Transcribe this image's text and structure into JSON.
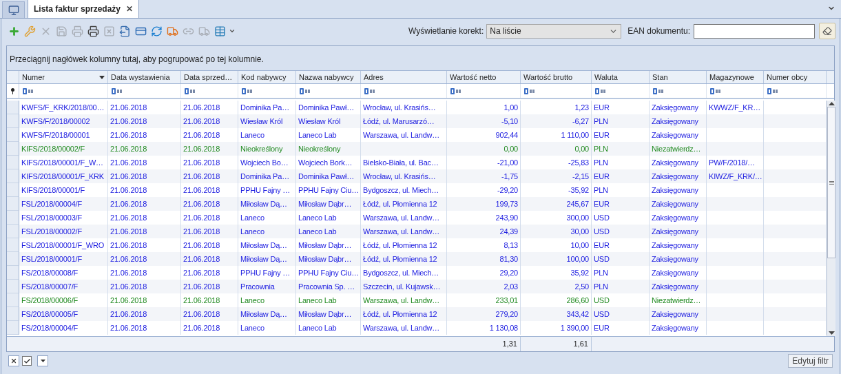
{
  "tabs": [
    {
      "kind": "home",
      "selected": false
    },
    {
      "kind": "document",
      "label": "Lista faktur sprzedaży",
      "close": "✕",
      "selected": true
    }
  ],
  "toolbar": [
    {
      "kind": "add",
      "disabled": false
    },
    {
      "kind": "edit",
      "disabled": false
    },
    {
      "kind": "delete",
      "disabled": true
    },
    {
      "kind": "approve",
      "disabled": true
    },
    {
      "kind": "print-preview",
      "disabled": true
    },
    {
      "kind": "print",
      "disabled": false
    },
    {
      "kind": "cancel",
      "disabled": true
    },
    {
      "kind": "export",
      "disabled": false
    },
    {
      "kind": "card",
      "disabled": false
    },
    {
      "kind": "refresh",
      "disabled": false
    },
    {
      "kind": "delivery",
      "disabled": false
    },
    {
      "kind": "link",
      "disabled": true
    },
    {
      "kind": "truck",
      "disabled": true
    },
    {
      "kind": "table",
      "disabled": false
    }
  ],
  "corrections_filter": {
    "label": "Wyświetlanie korekt:",
    "value": "Na liście"
  },
  "ean_field": {
    "label": "EAN dokumentu:"
  },
  "group_hint": "Przeciągnij nagłówek kolumny tutaj, aby pogrupować po tej kolumnie.",
  "table": {
    "columns": [
      {
        "label": "Numer",
        "sorted": true
      },
      {
        "label": "Data wystawienia",
        "sorted": false
      },
      {
        "label": "Data sprzed…",
        "sorted": false
      },
      {
        "label": "Kod nabywcy",
        "sorted": false
      },
      {
        "label": "Nazwa nabywcy",
        "sorted": false
      },
      {
        "label": "Adres",
        "sorted": false
      },
      {
        "label": "Wartość netto",
        "sorted": false
      },
      {
        "label": "Wartość brutto",
        "sorted": false
      },
      {
        "label": "Waluta",
        "sorted": false
      },
      {
        "label": "Stan",
        "sorted": false
      },
      {
        "label": "Magazynowe",
        "sorted": false
      },
      {
        "label": "Numer obcy",
        "sorted": false
      }
    ],
    "rows": [
      {
        "confirmed": true,
        "numer": "KWFS/F_KRK/2018/00…",
        "data_wystawienia": "21.06.2018",
        "data_sprzedazy": "21.06.2018",
        "kod": "Dominika Pa…",
        "nazwa": "Dominika Pawł…",
        "adres": "Wrocław, ul. Krasińs…",
        "netto": "1,00",
        "brutto": "1,23",
        "waluta": "EUR",
        "stan": "Zaksięgowany",
        "magazynowe": "KWWZ/F_KR…"
      },
      {
        "confirmed": true,
        "numer": "KWFS/F/2018/00002",
        "data_wystawienia": "21.06.2018",
        "data_sprzedazy": "21.06.2018",
        "kod": "Wiesław Król",
        "nazwa": "Wiesław Król",
        "adres": "Łódź, ul. Marusarzó…",
        "netto": "-5,10",
        "brutto": "-6,27",
        "waluta": "PLN",
        "stan": "Zaksięgowany"
      },
      {
        "confirmed": true,
        "numer": "KWFS/F/2018/00001",
        "data_wystawienia": "21.06.2018",
        "data_sprzedazy": "21.06.2018",
        "kod": "Laneco",
        "nazwa": "Laneco Lab",
        "adres": "Warszawa, ul. Landw…",
        "netto": "902,44",
        "brutto": "1 110,00",
        "waluta": "EUR",
        "stan": "Zaksięgowany"
      },
      {
        "confirmed": false,
        "numer": "KIFS/2018/00002/F",
        "data_wystawienia": "21.06.2018",
        "data_sprzedazy": "21.06.2018",
        "kod": "Nieokreślony",
        "nazwa": "Nieokreślony",
        "netto": "0,00",
        "brutto": "0,00",
        "waluta": "PLN",
        "stan": "Niezatwierdz…"
      },
      {
        "confirmed": true,
        "numer": "KIFS/2018/00001/F_W…",
        "data_wystawienia": "21.06.2018",
        "data_sprzedazy": "21.06.2018",
        "kod": "Wojciech Bo…",
        "nazwa": "Wojciech Bork…",
        "adres": "Bielsko-Biała, ul. Bac…",
        "netto": "-21,00",
        "brutto": "-25,83",
        "waluta": "PLN",
        "stan": "Zaksięgowany",
        "magazynowe": "PW/F/2018/…"
      },
      {
        "confirmed": true,
        "numer": "KIFS/2018/00001/F_KRK",
        "data_wystawienia": "21.06.2018",
        "data_sprzedazy": "21.06.2018",
        "kod": "Dominika Pa…",
        "nazwa": "Dominika Pawł…",
        "adres": "Wrocław, ul. Krasińs…",
        "netto": "-1,75",
        "brutto": "-2,15",
        "waluta": "EUR",
        "stan": "Zaksięgowany",
        "magazynowe": "KIWZ/F_KRK/…"
      },
      {
        "confirmed": true,
        "numer": "KIFS/2018/00001/F",
        "data_wystawienia": "21.06.2018",
        "data_sprzedazy": "21.06.2018",
        "kod": "PPHU Fajny …",
        "nazwa": "PPHU Fajny Ciu…",
        "adres": "Bydgoszcz, ul. Miech…",
        "netto": "-29,20",
        "brutto": "-35,92",
        "waluta": "PLN",
        "stan": "Zaksięgowany"
      },
      {
        "confirmed": true,
        "numer": "FSL/2018/00004/F",
        "data_wystawienia": "21.06.2018",
        "data_sprzedazy": "21.06.2018",
        "kod": "Miłosław Dą…",
        "nazwa": "Miłosław Dąbr…",
        "adres": "Łódź, ul. Płomienna 12",
        "netto": "199,73",
        "brutto": "245,67",
        "waluta": "EUR",
        "stan": "Zaksięgowany"
      },
      {
        "confirmed": true,
        "numer": "FSL/2018/00003/F",
        "data_wystawienia": "21.06.2018",
        "data_sprzedazy": "21.06.2018",
        "kod": "Laneco",
        "nazwa": "Laneco Lab",
        "adres": "Warszawa, ul. Landw…",
        "netto": "243,90",
        "brutto": "300,00",
        "waluta": "USD",
        "stan": "Zaksięgowany"
      },
      {
        "confirmed": true,
        "numer": "FSL/2018/00002/F",
        "data_wystawienia": "21.06.2018",
        "data_sprzedazy": "21.06.2018",
        "kod": "Laneco",
        "nazwa": "Laneco Lab",
        "adres": "Warszawa, ul. Landw…",
        "netto": "24,39",
        "brutto": "30,00",
        "waluta": "USD",
        "stan": "Zaksięgowany"
      },
      {
        "confirmed": true,
        "numer": "FSL/2018/00001/F_WRO",
        "data_wystawienia": "21.06.2018",
        "data_sprzedazy": "21.06.2018",
        "kod": "Miłosław Dą…",
        "nazwa": "Miłosław Dąbr…",
        "adres": "Łódź, ul. Płomienna 12",
        "netto": "8,13",
        "brutto": "10,00",
        "waluta": "EUR",
        "stan": "Zaksięgowany"
      },
      {
        "confirmed": true,
        "numer": "FSL/2018/00001/F",
        "data_wystawienia": "21.06.2018",
        "data_sprzedazy": "21.06.2018",
        "kod": "Miłosław Dą…",
        "nazwa": "Miłosław Dąbr…",
        "adres": "Łódź, ul. Płomienna 12",
        "netto": "81,30",
        "brutto": "100,00",
        "waluta": "USD",
        "stan": "Zaksięgowany"
      },
      {
        "confirmed": true,
        "numer": "FS/2018/00008/F",
        "data_wystawienia": "21.06.2018",
        "data_sprzedazy": "21.06.2018",
        "kod": "PPHU Fajny …",
        "nazwa": "PPHU Fajny Ciu…",
        "adres": "Bydgoszcz, ul. Miech…",
        "netto": "29,20",
        "brutto": "35,92",
        "waluta": "PLN",
        "stan": "Zaksięgowany"
      },
      {
        "confirmed": true,
        "numer": "FS/2018/00007/F",
        "data_wystawienia": "21.06.2018",
        "data_sprzedazy": "21.06.2018",
        "kod": "Pracownia",
        "nazwa": "Pracownia Sp. …",
        "adres": "Szczecin, ul. Kujawsk…",
        "netto": "2,03",
        "brutto": "2,50",
        "waluta": "PLN",
        "stan": "Zaksięgowany"
      },
      {
        "confirmed": false,
        "numer": "FS/2018/00006/F",
        "data_wystawienia": "21.06.2018",
        "data_sprzedazy": "21.06.2018",
        "kod": "Laneco",
        "nazwa": "Laneco Lab",
        "adres": "Warszawa, ul. Landw…",
        "netto": "233,01",
        "brutto": "286,60",
        "waluta": "USD",
        "stan": "Niezatwierdz…"
      },
      {
        "confirmed": true,
        "numer": "FS/2018/00005/F",
        "data_wystawienia": "21.06.2018",
        "data_sprzedazy": "21.06.2018",
        "kod": "Miłosław Dą…",
        "nazwa": "Miłosław Dąbr…",
        "adres": "Łódź, ul. Płomienna 12",
        "netto": "279,20",
        "brutto": "343,42",
        "waluta": "USD",
        "stan": "Zaksięgowany"
      },
      {
        "confirmed": true,
        "numer": "FS/2018/00004/F",
        "data_wystawienia": "21.06.2018",
        "data_sprzedazy": "21.06.2018",
        "kod": "Laneco",
        "nazwa": "Laneco Lab",
        "adres": "Warszawa, ul. Landw…",
        "netto": "1 130,08",
        "brutto": "1 390,00",
        "waluta": "EUR",
        "stan": "Zaksięgowany"
      }
    ],
    "totals": {
      "netto": "1,31",
      "brutto": "1,61"
    }
  },
  "footer": {
    "filter_enabled": true,
    "edit_filter": "Edytuj filtr"
  }
}
